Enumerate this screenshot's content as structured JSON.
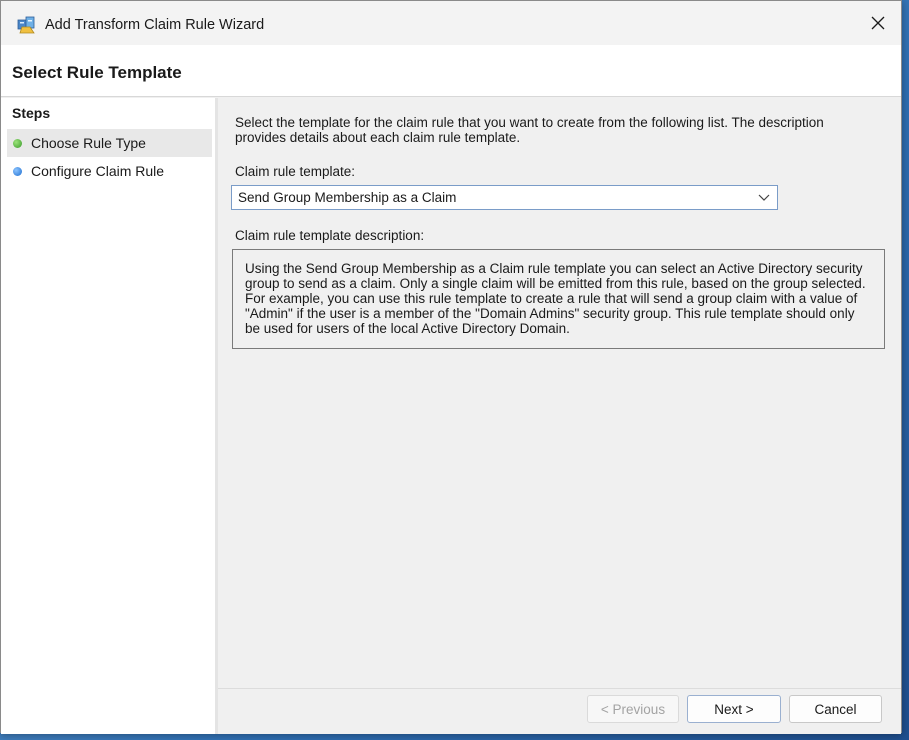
{
  "window": {
    "title": "Add Transform Claim Rule Wizard"
  },
  "header": {
    "title": "Select Rule Template"
  },
  "sidebar": {
    "heading": "Steps",
    "items": [
      {
        "label": "Choose Rule Type",
        "status": "current",
        "color": "#3a9a2a"
      },
      {
        "label": "Configure Claim Rule",
        "status": "pending",
        "color": "#1f6fd0"
      }
    ]
  },
  "main": {
    "intro": "Select the template for the claim rule that you want to create from the following list. The description provides details about each claim rule template.",
    "template_label": "Claim rule template:",
    "template_selected": "Send Group Membership as a Claim",
    "description_label": "Claim rule template description:",
    "description": "Using the Send Group Membership as a Claim rule template you can select an Active Directory security group to send as a claim. Only a single claim will be emitted from this rule, based on the group selected. For example, you can use this rule template to create a rule that will send a group claim with a value of \"Admin\" if the user is a member of the \"Domain Admins\" security group.  This rule template should only be used for users of the local Active Directory Domain."
  },
  "footer": {
    "previous_label": "< Previous",
    "next_label": "Next >",
    "cancel_label": "Cancel"
  }
}
